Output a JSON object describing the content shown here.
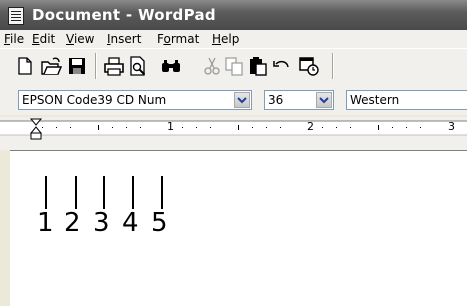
{
  "window": {
    "title": "Document - WordPad"
  },
  "menu": [
    {
      "id": "file",
      "label": "File",
      "accel": "F",
      "rest": "ile"
    },
    {
      "id": "edit",
      "label": "Edit",
      "accel": "E",
      "rest": "dit"
    },
    {
      "id": "view",
      "label": "View",
      "accel": "V",
      "rest": "iew"
    },
    {
      "id": "insert",
      "label": "Insert",
      "accel": "I",
      "rest": "nsert"
    },
    {
      "id": "format",
      "label": "Format",
      "accel_pre": "F",
      "accel": "o",
      "rest": "rmat"
    },
    {
      "id": "help",
      "label": "Help",
      "accel": "H",
      "rest": "elp"
    }
  ],
  "toolbar": {
    "buttons": [
      "new-icon",
      "open-icon",
      "save-icon",
      "print-icon",
      "print-preview-icon",
      "find-icon",
      "cut-icon",
      "copy-icon",
      "paste-icon",
      "undo-icon",
      "date-time-icon"
    ]
  },
  "format": {
    "font": "EPSON Code39 CD Num",
    "size": "36",
    "script": "Western"
  },
  "ruler": {
    "numbers": [
      "1",
      "2",
      "3"
    ]
  },
  "document": {
    "digits": [
      "1",
      "2",
      "3",
      "4",
      "5"
    ]
  },
  "colors": {
    "title_bar": "#5c5c5c",
    "chrome": "#f1f0ec",
    "page": "#ffffff"
  }
}
